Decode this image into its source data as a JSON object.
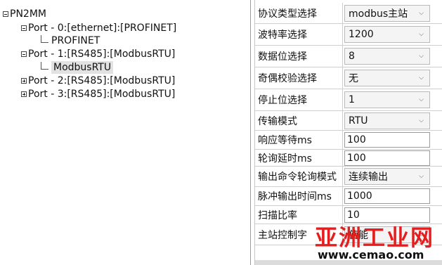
{
  "tree": {
    "root": "PN2MM",
    "port0": "Port - 0:[ethernet]:[PROFINET]",
    "port0_child": "PROFINET",
    "port1": "Port - 1:[RS485]:[ModbusRTU]",
    "port1_child": "ModbusRTU",
    "port2": "Port - 2:[RS485]:[ModbusRTU]",
    "port3": "Port - 3:[RS485]:[ModbusRTU]"
  },
  "props": {
    "protocol": {
      "label": "协议类型选择",
      "value": "modbus主站"
    },
    "baud": {
      "label": "波特率选择",
      "value": "1200"
    },
    "databits": {
      "label": "数据位选择",
      "value": "8"
    },
    "parity": {
      "label": "奇偶校验选择",
      "value": "无"
    },
    "stopbits": {
      "label": "停止位选择",
      "value": "1"
    },
    "mode": {
      "label": "传输模式",
      "value": "RTU"
    },
    "response": {
      "label": "响应等待ms",
      "value": "100"
    },
    "poll_delay": {
      "label": "轮询延时ms",
      "value": "100"
    },
    "output_mode": {
      "label": "输出命令轮询模式",
      "value": "连续输出"
    },
    "pulse": {
      "label": "脉冲输出时间ms",
      "value": "1000"
    },
    "scan": {
      "label": "扫描比率",
      "value": "10"
    },
    "master": {
      "label": "主站控制字",
      "value": "使能"
    }
  },
  "watermark": {
    "text": "亚洲工业网",
    "url": "www.cemao.com"
  },
  "colors": {
    "watermark": "#e41e1e"
  }
}
